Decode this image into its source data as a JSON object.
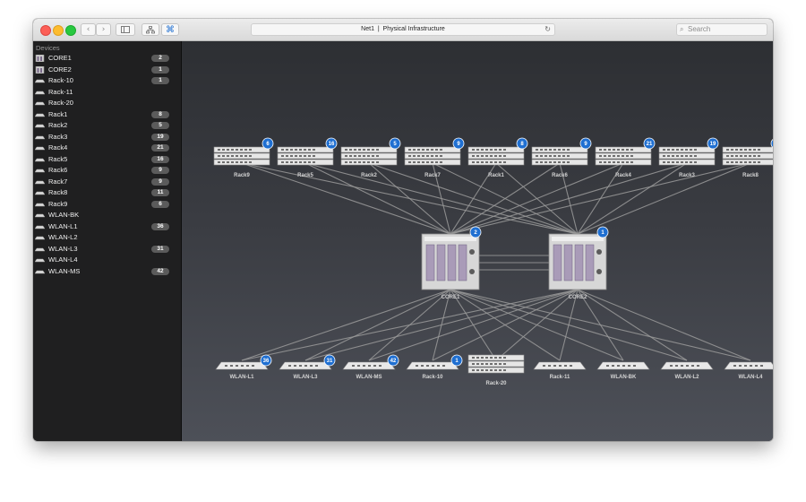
{
  "window": {
    "title": "Net1  |  Physical Infrastructure",
    "search_placeholder": "Search",
    "icons": [
      "back-arrow-icon",
      "forward-arrow-icon",
      "sidebar-toggle-icon",
      "network-topology-icon",
      "command-icon",
      "reload-icon",
      "search-icon"
    ]
  },
  "colors": {
    "accent": "#1f6fd1",
    "sidebar_bg": "#1f1f20",
    "count_pill": "#5b5b5b",
    "link_line": "#9a9a9a"
  },
  "sidebar": {
    "header": "Devices",
    "items": [
      {
        "label": "CORE1",
        "count": "2",
        "icon": "chassis-icon"
      },
      {
        "label": "CORE2",
        "count": "1",
        "icon": "chassis-icon"
      },
      {
        "label": "Rack-10",
        "count": "1",
        "icon": "switch-icon"
      },
      {
        "label": "Rack-11",
        "count": "",
        "icon": "switch-icon"
      },
      {
        "label": "Rack-20",
        "count": "",
        "icon": "switch-icon"
      },
      {
        "label": "Rack1",
        "count": "8",
        "icon": "switch-icon"
      },
      {
        "label": "Rack2",
        "count": "5",
        "icon": "switch-icon"
      },
      {
        "label": "Rack3",
        "count": "19",
        "icon": "switch-icon"
      },
      {
        "label": "Rack4",
        "count": "21",
        "icon": "switch-icon"
      },
      {
        "label": "Rack5",
        "count": "16",
        "icon": "switch-icon"
      },
      {
        "label": "Rack6",
        "count": "9",
        "icon": "switch-icon"
      },
      {
        "label": "Rack7",
        "count": "9",
        "icon": "switch-icon"
      },
      {
        "label": "Rack8",
        "count": "11",
        "icon": "switch-icon"
      },
      {
        "label": "Rack9",
        "count": "6",
        "icon": "switch-icon"
      },
      {
        "label": "WLAN-BK",
        "count": "",
        "icon": "switch-icon"
      },
      {
        "label": "WLAN-L1",
        "count": "36",
        "icon": "switch-icon"
      },
      {
        "label": "WLAN-L2",
        "count": "",
        "icon": "switch-icon"
      },
      {
        "label": "WLAN-L3",
        "count": "31",
        "icon": "switch-icon"
      },
      {
        "label": "WLAN-L4",
        "count": "",
        "icon": "switch-icon"
      },
      {
        "label": "WLAN-MS",
        "count": "42",
        "icon": "switch-icon"
      }
    ]
  },
  "topology": {
    "top_row": [
      {
        "label": "Rack9",
        "badge": "6",
        "kind": "rack"
      },
      {
        "label": "Rack5",
        "badge": "16",
        "kind": "rack"
      },
      {
        "label": "Rack2",
        "badge": "5",
        "kind": "rack"
      },
      {
        "label": "Rack7",
        "badge": "9",
        "kind": "rack"
      },
      {
        "label": "Rack1",
        "badge": "8",
        "kind": "rack"
      },
      {
        "label": "Rack6",
        "badge": "9",
        "kind": "rack"
      },
      {
        "label": "Rack4",
        "badge": "21",
        "kind": "rack"
      },
      {
        "label": "Rack3",
        "badge": "19",
        "kind": "rack"
      },
      {
        "label": "Rack8",
        "badge": "11",
        "kind": "rack"
      }
    ],
    "cores": [
      {
        "label": "CORE1",
        "badge": "2"
      },
      {
        "label": "CORE2",
        "badge": "1"
      }
    ],
    "bottom_row": [
      {
        "label": "WLAN-L1",
        "badge": "36",
        "kind": "wlan"
      },
      {
        "label": "WLAN-L3",
        "badge": "31",
        "kind": "wlan"
      },
      {
        "label": "WLAN-MS",
        "badge": "42",
        "kind": "wlan"
      },
      {
        "label": "Rack-10",
        "badge": "1",
        "kind": "wlan"
      },
      {
        "label": "Rack-20",
        "badge": "",
        "kind": "rack"
      },
      {
        "label": "Rack-11",
        "badge": "",
        "kind": "wlan"
      },
      {
        "label": "WLAN-BK",
        "badge": "",
        "kind": "wlan"
      },
      {
        "label": "WLAN-L2",
        "badge": "",
        "kind": "wlan"
      },
      {
        "label": "WLAN-L4",
        "badge": "",
        "kind": "wlan"
      }
    ]
  }
}
